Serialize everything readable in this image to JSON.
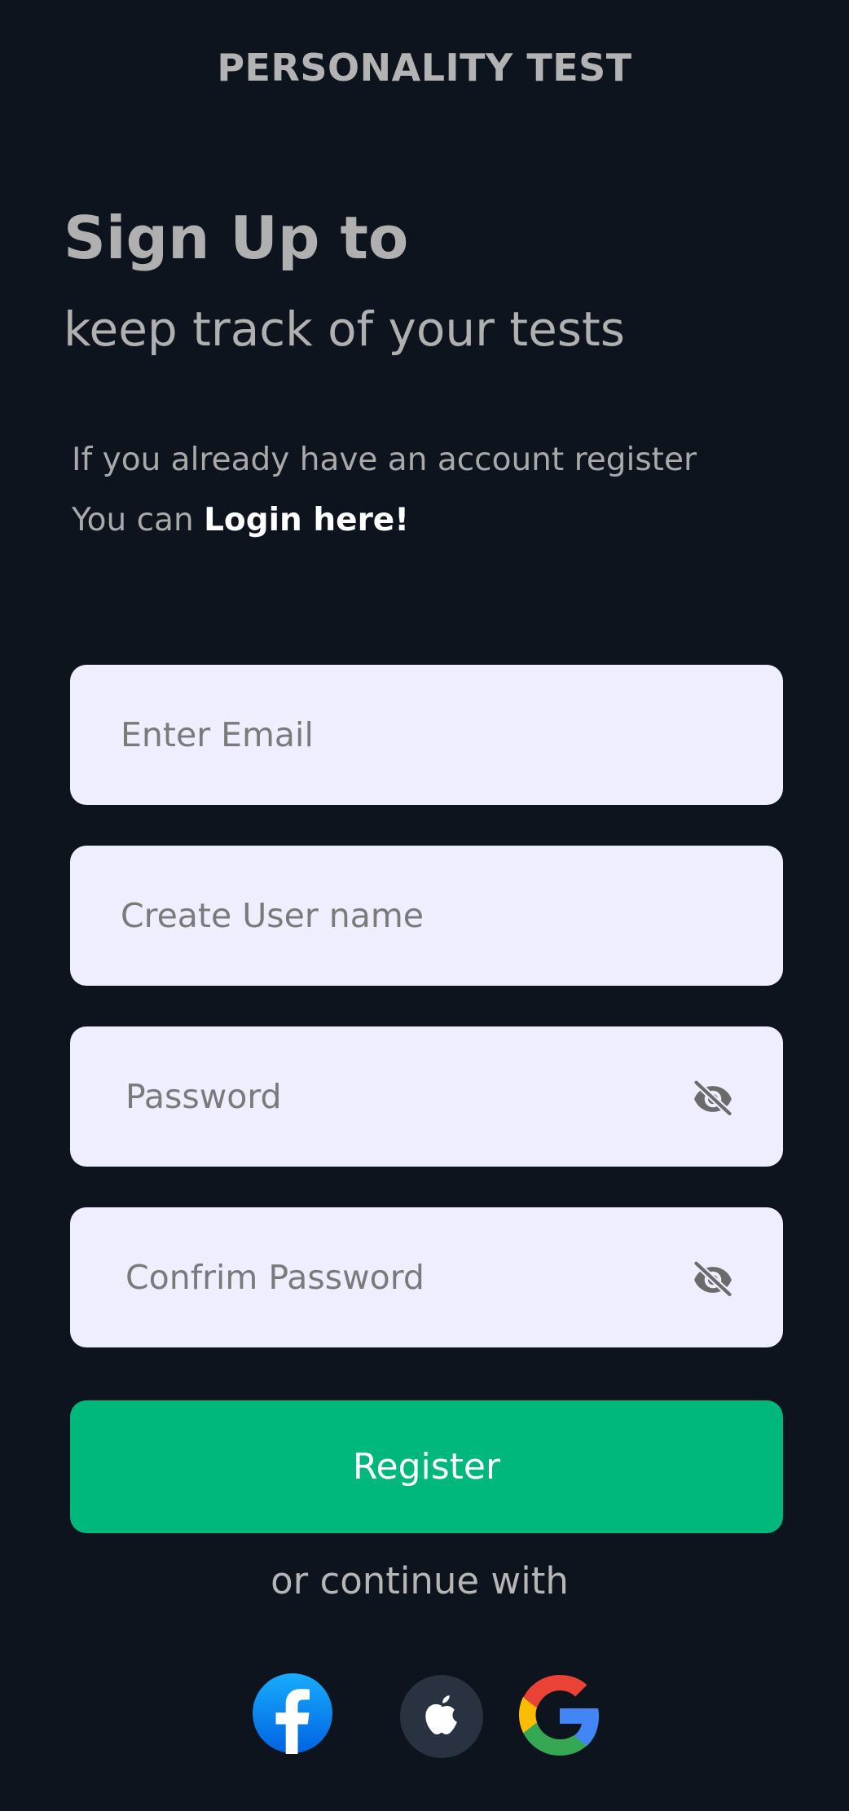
{
  "app": {
    "title": "PERSONALITY TEST"
  },
  "heading": {
    "main": "Sign Up to",
    "sub": "keep track of your tests"
  },
  "info": {
    "line1": "If you already have an account register",
    "line2_prefix": "You can ",
    "login_link": "Login here!"
  },
  "form": {
    "email_placeholder": "Enter Email",
    "username_placeholder": "Create User name",
    "password_placeholder": "Password",
    "confirm_password_placeholder": "Confrim Password",
    "register_label": "Register"
  },
  "continue_text": "or continue with",
  "social": [
    {
      "name": "facebook",
      "icon": "facebook-icon"
    },
    {
      "name": "apple",
      "icon": "apple-icon"
    },
    {
      "name": "google",
      "icon": "google-icon"
    }
  ],
  "colors": {
    "background": "#0e141e",
    "field_background": "#efeefe",
    "register_button": "#00b87c",
    "facebook_blue": "#1877f2",
    "apple_circle": "#283241"
  }
}
